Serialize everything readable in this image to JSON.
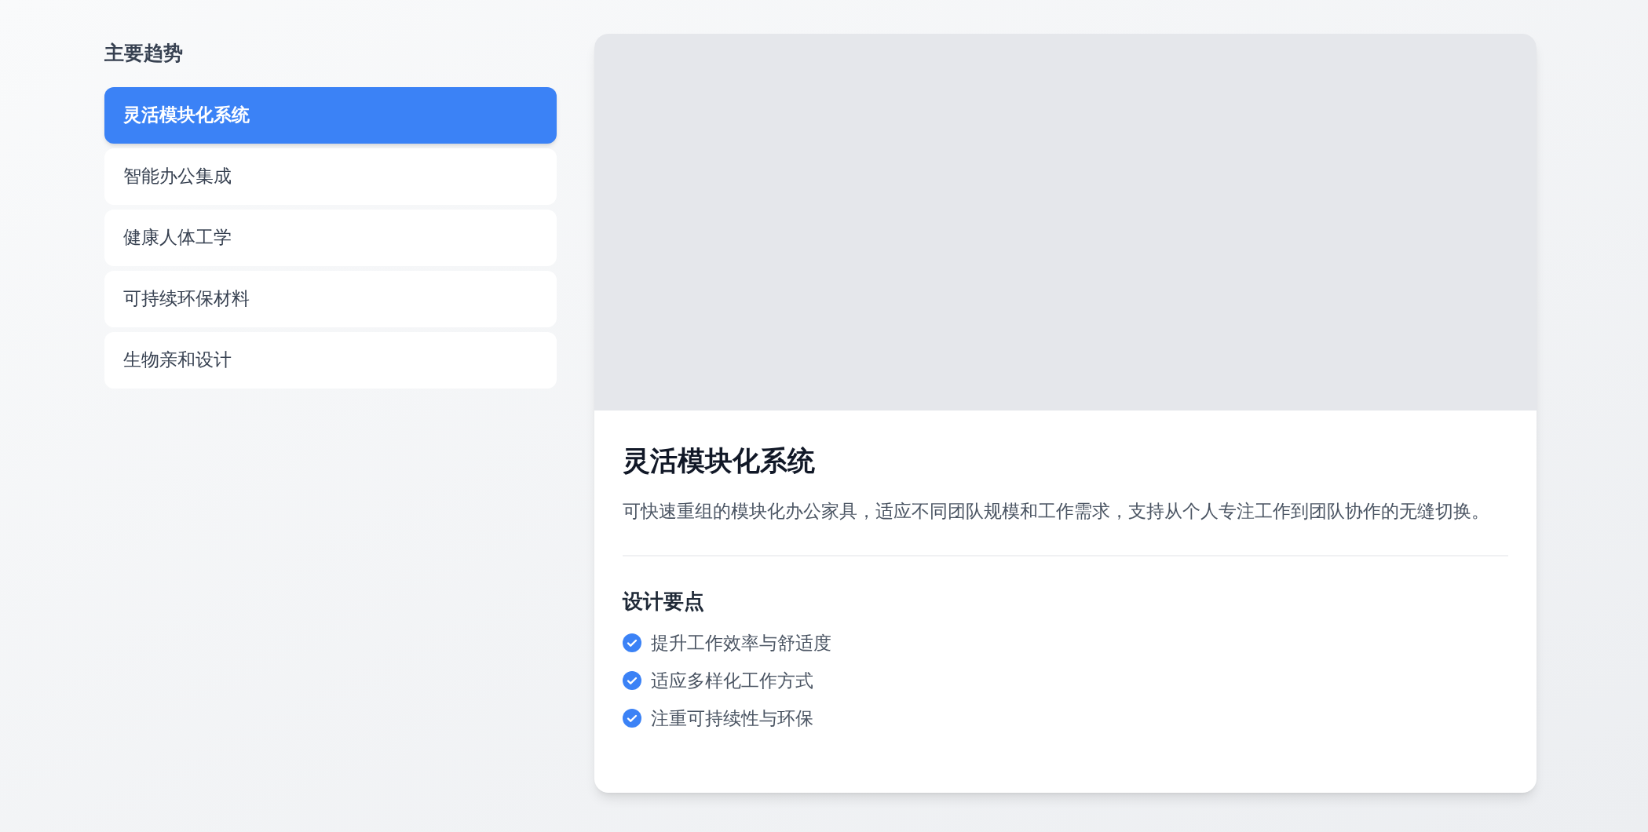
{
  "sidebar": {
    "title": "主要趋势",
    "items": [
      {
        "label": "灵活模块化系统",
        "selected": true
      },
      {
        "label": "智能办公集成",
        "selected": false
      },
      {
        "label": "健康人体工学",
        "selected": false
      },
      {
        "label": "可持续环保材料",
        "selected": false
      },
      {
        "label": "生物亲和设计",
        "selected": false
      }
    ]
  },
  "detail": {
    "title": "灵活模块化系统",
    "description": "可快速重组的模块化办公家具，适应不同团队规模和工作需求，支持从个人专注工作到团队协作的无缝切换。",
    "points_title": "设计要点",
    "points": [
      "提升工作效率与舒适度",
      "适应多样化工作方式",
      "注重可持续性与环保"
    ]
  }
}
